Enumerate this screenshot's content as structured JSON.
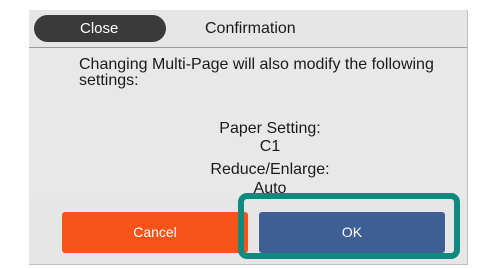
{
  "header": {
    "close_label": "Close",
    "title": "Confirmation"
  },
  "message": "Changing Multi-Page will also modify the following settings:",
  "settings": [
    {
      "label": "Paper Setting:",
      "value": "C1"
    },
    {
      "label": "Reduce/Enlarge:",
      "value": "Auto"
    }
  ],
  "buttons": {
    "cancel_label": "Cancel",
    "ok_label": "OK"
  },
  "colors": {
    "close_button": "#3a3a3a",
    "cancel_button": "#f7541a",
    "ok_button": "#3f5f94",
    "highlight": "#0f8a7f",
    "background": "#e8e8e8"
  }
}
